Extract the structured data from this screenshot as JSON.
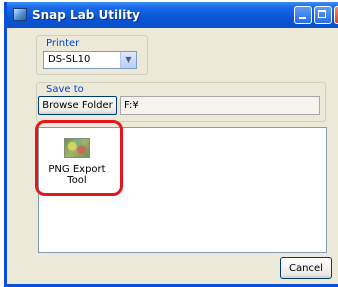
{
  "window": {
    "title": "Snap Lab Utility"
  },
  "printer": {
    "label": "Printer",
    "selected": "DS-SL10"
  },
  "save_to": {
    "label": "Save to",
    "browse_label": "Browse Folder",
    "path": "F:¥"
  },
  "tools": [
    {
      "label_line1": "PNG Export",
      "label_line2": "Tool",
      "icon": "png-export-tool-icon"
    }
  ],
  "footer": {
    "cancel_label": "Cancel"
  },
  "colors": {
    "titlebar": "#0a56d8",
    "group_label": "#0046d5",
    "highlight": "#e5161d",
    "window_bg": "#ece9d8"
  }
}
